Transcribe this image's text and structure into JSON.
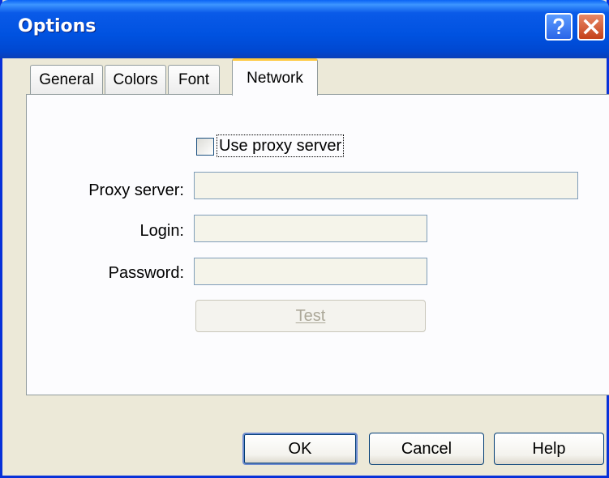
{
  "window": {
    "title": "Options"
  },
  "titlebar_buttons": {
    "help": "?",
    "close": "X"
  },
  "tabs": [
    {
      "label": "General",
      "active": false
    },
    {
      "label": "Colors",
      "active": false
    },
    {
      "label": "Font",
      "active": false
    },
    {
      "label": "Network",
      "active": true
    }
  ],
  "network": {
    "use_proxy": {
      "label": "Use proxy server",
      "checked": false
    },
    "proxy_server": {
      "label": "Proxy server:",
      "value": ""
    },
    "login": {
      "label": "Login:",
      "value": ""
    },
    "password": {
      "label": "Password:",
      "value": ""
    },
    "test_button": {
      "label": "Test",
      "enabled": false
    }
  },
  "buttons": {
    "ok": "OK",
    "cancel": "Cancel",
    "help": "Help"
  },
  "colors": {
    "titlebar": "#0052e0",
    "face": "#ece9d8",
    "tab_highlight": "#ffc83c",
    "close": "#c4411a"
  }
}
